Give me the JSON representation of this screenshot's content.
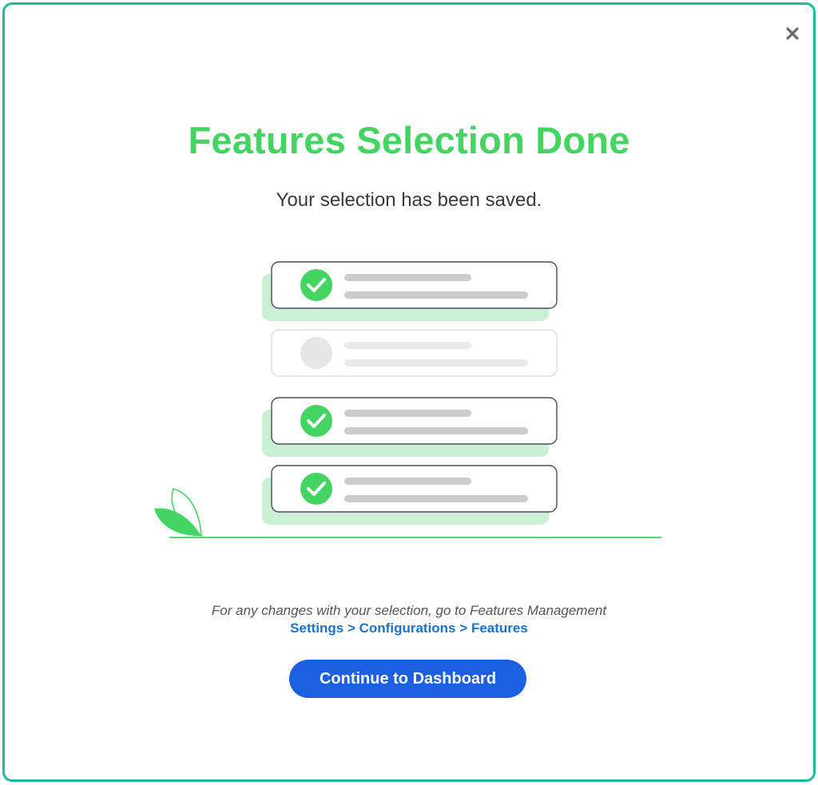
{
  "modal": {
    "close_icon": "close-icon",
    "title": "Features Selection Done",
    "subtitle": "Your selection has been saved.",
    "illustration": {
      "items": [
        {
          "checked": true
        },
        {
          "checked": false
        },
        {
          "checked": true
        },
        {
          "checked": true
        }
      ]
    },
    "hint": "For any changes with your selection, go to Features Management",
    "path": {
      "settings": "Settings",
      "configurations": "Configurations",
      "features": "Features",
      "separator": ">"
    },
    "continue_label": "Continue to Dashboard"
  },
  "colors": {
    "accent_green": "#43d461",
    "border_teal": "#1bbc9b",
    "link_blue": "#1a73c9",
    "button_blue": "#1c5fe1"
  }
}
